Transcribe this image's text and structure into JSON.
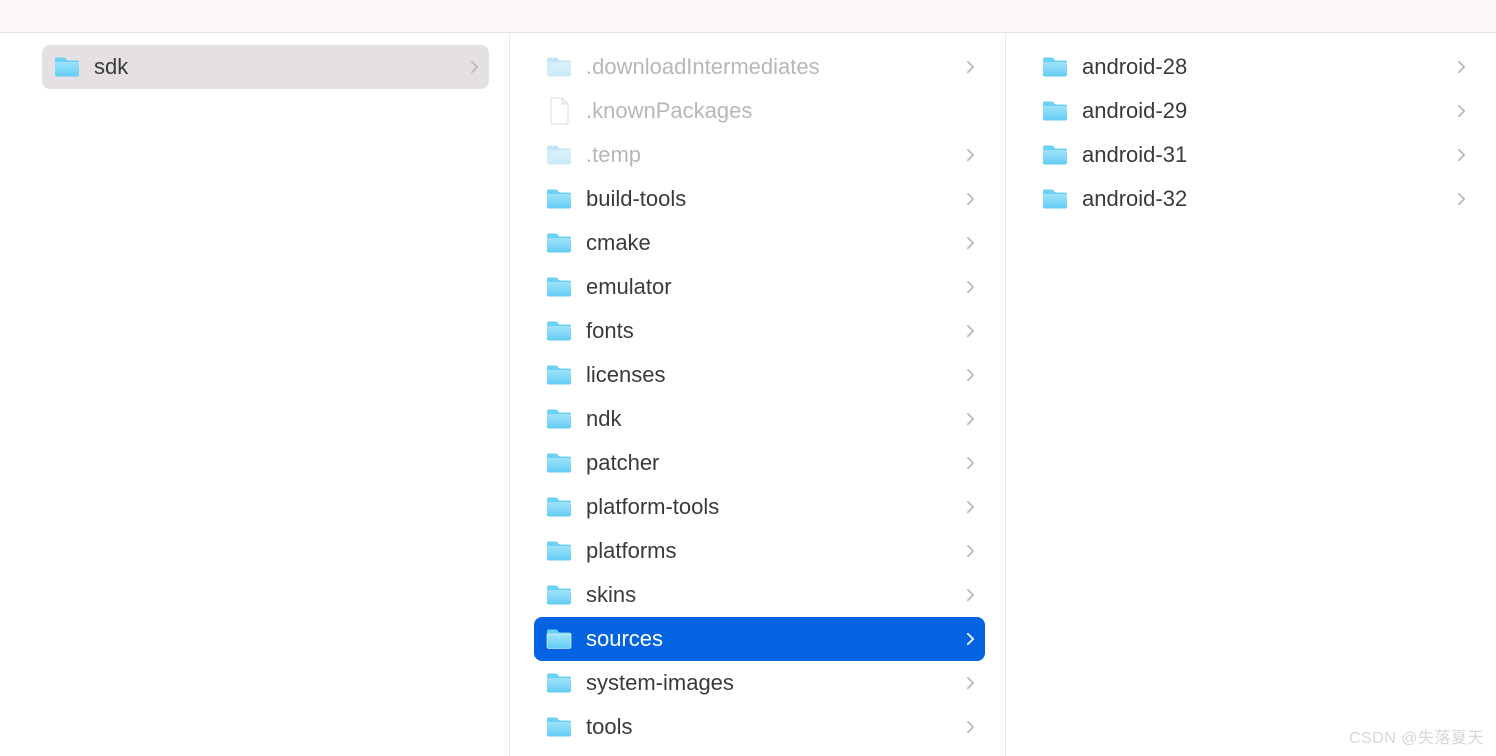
{
  "watermark": "CSDN @失落夏天",
  "columns": [
    {
      "items": [
        {
          "name": "sdk",
          "type": "folder",
          "dim": false,
          "arrow": true,
          "selected": "gray"
        }
      ]
    },
    {
      "items": [
        {
          "name": ".downloadIntermediates",
          "type": "folder",
          "dim": true,
          "arrow": true,
          "selected": null
        },
        {
          "name": ".knownPackages",
          "type": "file",
          "dim": true,
          "arrow": false,
          "selected": null
        },
        {
          "name": ".temp",
          "type": "folder",
          "dim": true,
          "arrow": true,
          "selected": null
        },
        {
          "name": "build-tools",
          "type": "folder",
          "dim": false,
          "arrow": true,
          "selected": null
        },
        {
          "name": "cmake",
          "type": "folder",
          "dim": false,
          "arrow": true,
          "selected": null
        },
        {
          "name": "emulator",
          "type": "folder",
          "dim": false,
          "arrow": true,
          "selected": null
        },
        {
          "name": "fonts",
          "type": "folder",
          "dim": false,
          "arrow": true,
          "selected": null
        },
        {
          "name": "licenses",
          "type": "folder",
          "dim": false,
          "arrow": true,
          "selected": null
        },
        {
          "name": "ndk",
          "type": "folder",
          "dim": false,
          "arrow": true,
          "selected": null
        },
        {
          "name": "patcher",
          "type": "folder",
          "dim": false,
          "arrow": true,
          "selected": null
        },
        {
          "name": "platform-tools",
          "type": "folder",
          "dim": false,
          "arrow": true,
          "selected": null
        },
        {
          "name": "platforms",
          "type": "folder",
          "dim": false,
          "arrow": true,
          "selected": null
        },
        {
          "name": "skins",
          "type": "folder",
          "dim": false,
          "arrow": true,
          "selected": null
        },
        {
          "name": "sources",
          "type": "folder",
          "dim": false,
          "arrow": true,
          "selected": "blue"
        },
        {
          "name": "system-images",
          "type": "folder",
          "dim": false,
          "arrow": true,
          "selected": null
        },
        {
          "name": "tools",
          "type": "folder",
          "dim": false,
          "arrow": true,
          "selected": null
        }
      ]
    },
    {
      "items": [
        {
          "name": "android-28",
          "type": "folder",
          "dim": false,
          "arrow": true,
          "selected": null
        },
        {
          "name": "android-29",
          "type": "folder",
          "dim": false,
          "arrow": true,
          "selected": null
        },
        {
          "name": "android-31",
          "type": "folder",
          "dim": false,
          "arrow": true,
          "selected": null
        },
        {
          "name": "android-32",
          "type": "folder",
          "dim": false,
          "arrow": true,
          "selected": null
        }
      ]
    }
  ]
}
